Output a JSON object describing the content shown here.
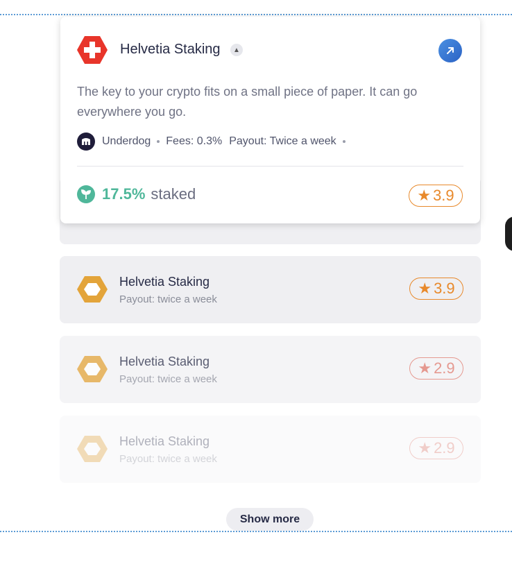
{
  "popover": {
    "title": "Helvetia Staking",
    "description": "The key to your crypto fits on a small piece of paper. It can go everywhere you go.",
    "operator": "Underdog",
    "fees": "Fees: 0.3%",
    "payout": "Payout: Twice a week",
    "staked_pct": "17.5%",
    "staked_label": "staked",
    "rating": "3.9"
  },
  "list": [
    {
      "title": "Helvetia Staking",
      "subtitle": "Payout: twice a week",
      "rating": "3.9"
    },
    {
      "title": "Helvetia Staking",
      "subtitle": "Payout: twice a week",
      "rating": "2.9"
    },
    {
      "title": "Helvetia Staking",
      "subtitle": "Payout: twice a week",
      "rating": "2.9"
    }
  ],
  "show_more": "Show more",
  "colors": {
    "accent_green": "#4fb79a",
    "rating_orange": "#e8892b",
    "rating_salmon": "#e07b6e",
    "swiss_red": "#e8352a",
    "hex_gold": "#e3a43a",
    "link_blue": "#3a7bd5"
  },
  "icons": {
    "popover_logo": "swiss-flag-icon",
    "chevron": "chevron-up-icon",
    "external": "external-link-icon",
    "operator": "underdog-avatar-icon",
    "staked": "leaf-icon",
    "star": "star-icon",
    "item_logo": "hexagon-icon"
  }
}
